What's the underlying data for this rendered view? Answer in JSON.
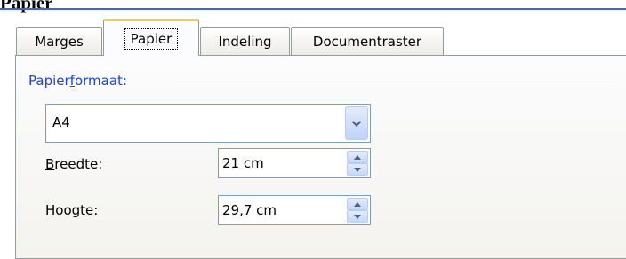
{
  "heading": "Papier",
  "tabs": [
    {
      "label": "Marges",
      "active": false
    },
    {
      "label": "Papier",
      "active": true
    },
    {
      "label": "Indeling",
      "active": false
    },
    {
      "label": "Documentraster",
      "active": false
    }
  ],
  "paper_size": {
    "section_title_pre": "Papier",
    "section_title_key": "f",
    "section_title_post": "ormaat:",
    "selected": "A4"
  },
  "width": {
    "label_key": "B",
    "label_rest": "reedte:",
    "value": "21 cm"
  },
  "height": {
    "label_key": "H",
    "label_rest": "oogte:",
    "value": "29,7 cm"
  },
  "colors": {
    "accent_blue": "#1a46c8",
    "tab_highlight": "#ffc83c",
    "border": "#919b9c"
  }
}
